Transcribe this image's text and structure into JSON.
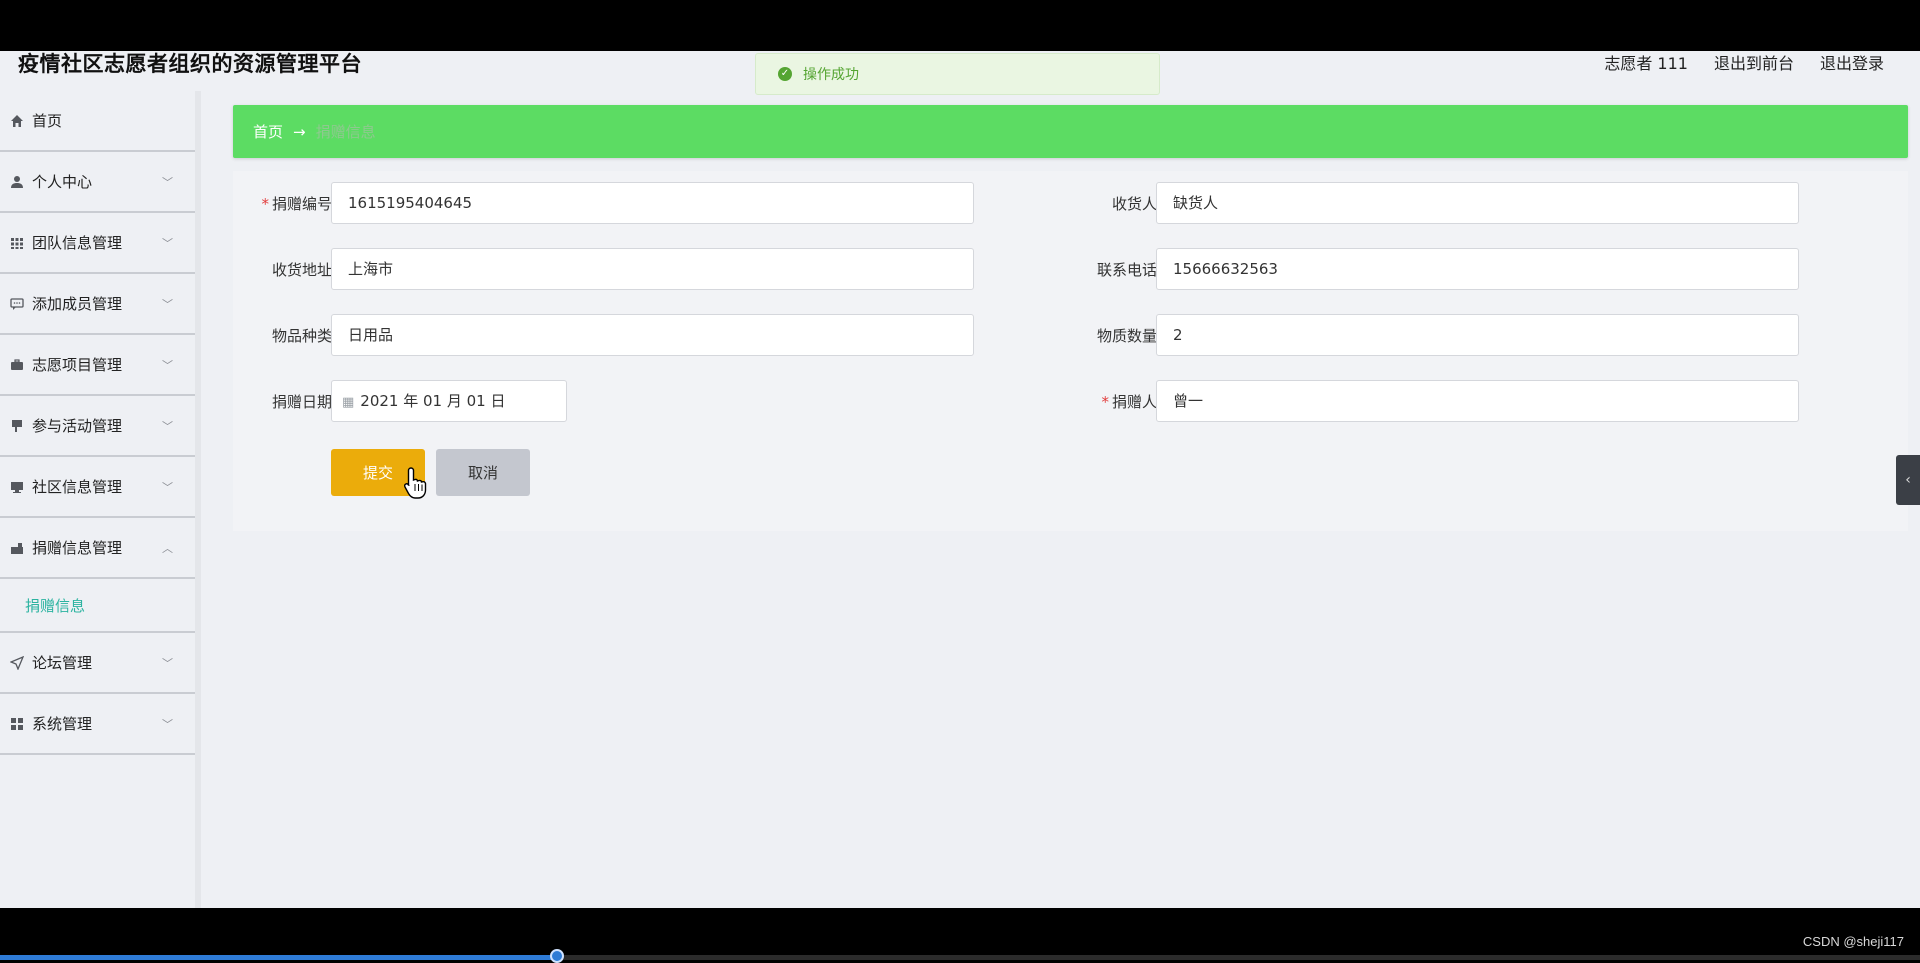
{
  "header": {
    "title": "疫情社区志愿者组织的资源管理平台",
    "user": "志愿者 111",
    "to_front": "退出到前台",
    "logout": "退出登录"
  },
  "toast": {
    "message": "操作成功"
  },
  "sidebar": {
    "items": [
      {
        "label": "首页",
        "icon": "home-icon"
      },
      {
        "label": "个人中心",
        "icon": "user-icon"
      },
      {
        "label": "团队信息管理",
        "icon": "grid-icon"
      },
      {
        "label": "添加成员管理",
        "icon": "chat-icon"
      },
      {
        "label": "志愿项目管理",
        "icon": "briefcase-icon"
      },
      {
        "label": "参与活动管理",
        "icon": "flag-icon"
      },
      {
        "label": "社区信息管理",
        "icon": "monitor-icon"
      },
      {
        "label": "捐赠信息管理",
        "icon": "donate-icon"
      },
      {
        "label": "论坛管理",
        "icon": "send-icon"
      },
      {
        "label": "系统管理",
        "icon": "apps-icon"
      }
    ],
    "submenu_label": "捐赠信息"
  },
  "breadcrumb": {
    "home": "首页",
    "arrow": "→",
    "current": "捐赠信息"
  },
  "form": {
    "donation_no": {
      "label": "捐赠编号",
      "value": "1615195404645",
      "required": true
    },
    "receiver": {
      "label": "收货人",
      "value": "缺货人"
    },
    "address": {
      "label": "收货地址",
      "value": "上海市"
    },
    "phone": {
      "label": "联系电话",
      "value": "15666632563"
    },
    "category": {
      "label": "物品种类",
      "value": "日用品"
    },
    "quantity": {
      "label": "物质数量",
      "value": "2"
    },
    "date": {
      "label": "捐赠日期",
      "value": "2021 年 01 月 01 日"
    },
    "donor": {
      "label": "捐赠人",
      "value": "曾一",
      "required": true
    },
    "submit": "提交",
    "cancel": "取消"
  },
  "watermark": "CSDN @sheji117",
  "video": {
    "progress": 0.29
  },
  "colors": {
    "breadcrumb": "#5cdc63",
    "submit": "#ebac0b",
    "accent": "#2bb3a0"
  }
}
